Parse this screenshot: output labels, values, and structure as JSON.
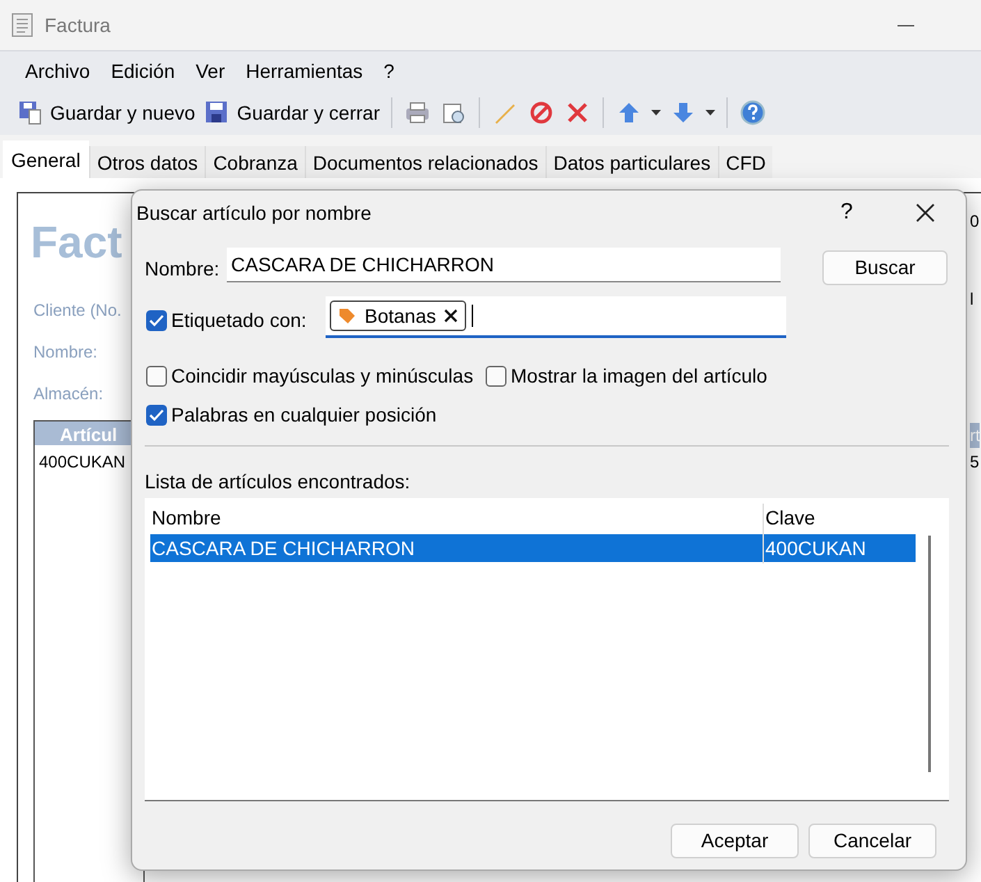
{
  "window": {
    "title": "Factura"
  },
  "menu": [
    "Archivo",
    "Edición",
    "Ver",
    "Herramientas",
    "?"
  ],
  "toolbar": [
    {
      "kind": "save-new",
      "label": "Guardar y nuevo"
    },
    {
      "kind": "save-close",
      "label": "Guardar y cerrar"
    },
    {
      "kind": "sep"
    },
    {
      "kind": "print"
    },
    {
      "kind": "preview"
    },
    {
      "kind": "sep"
    },
    {
      "kind": "edit"
    },
    {
      "kind": "cancel"
    },
    {
      "kind": "delete"
    },
    {
      "kind": "sep"
    },
    {
      "kind": "up"
    },
    {
      "kind": "down"
    },
    {
      "kind": "sep"
    },
    {
      "kind": "help"
    }
  ],
  "tabs": [
    {
      "label": "General",
      "selected": true
    },
    {
      "label": "Otros datos",
      "selected": false
    },
    {
      "label": "Cobranza",
      "selected": false
    },
    {
      "label": "Documentos relacionados",
      "selected": false
    },
    {
      "label": "Datos particulares",
      "selected": false
    },
    {
      "label": "CFD",
      "selected": false
    }
  ],
  "form": {
    "heading": "Fact",
    "labels": [
      "Cliente (No.",
      "Nombre:",
      "Almacén:"
    ],
    "grid_header": "Artícul",
    "grid_cell": "400CUKAN",
    "edge_texts": [
      "0",
      "l",
      "rt",
      "5"
    ]
  },
  "dialog": {
    "title": "Buscar artículo por nombre",
    "help": "?",
    "name_label": "Nombre:",
    "name_value": "CASCARA DE CHICHARRON",
    "search_button": "Buscar",
    "tagged": {
      "label": "Etiquetado con:",
      "checked": true,
      "tag": "Botanas"
    },
    "options": [
      {
        "label": "Coincidir mayúsculas y minúsculas",
        "checked": false
      },
      {
        "label": "Mostrar la imagen del artículo",
        "checked": false
      },
      {
        "label": "Palabras en cualquier posición",
        "checked": true
      }
    ],
    "list_label": "Lista de artículos encontrados:",
    "columns": [
      "Nombre",
      "Clave"
    ],
    "rows": [
      {
        "cells": [
          "CASCARA DE CHICHARRON",
          "400CUKAN"
        ],
        "selected": true
      }
    ],
    "buttons": [
      "Aceptar",
      "Cancelar"
    ]
  }
}
